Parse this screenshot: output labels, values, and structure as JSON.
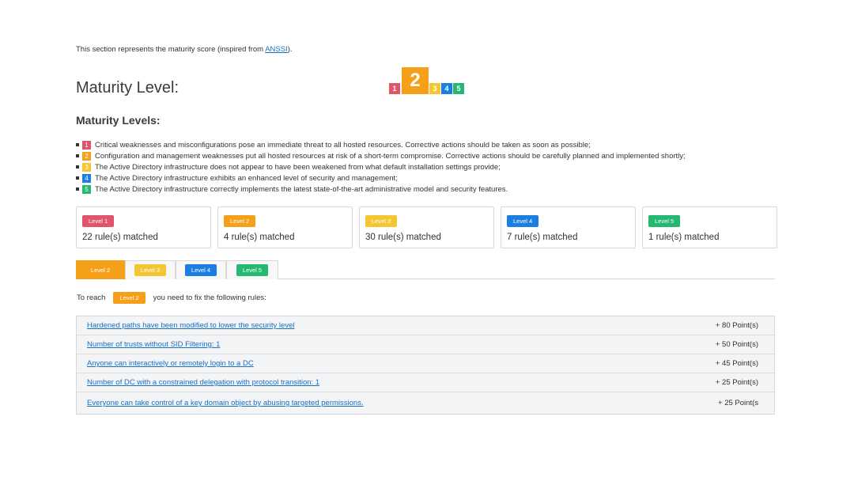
{
  "intro": {
    "text_before": "This section represents the maturity score (inspired from ",
    "link": "ANSSI",
    "text_after": ")."
  },
  "maturity_title": "Maturity Level:",
  "current_level": "2",
  "scale": [
    {
      "label": "1",
      "color": "#e0556b"
    },
    {
      "label": "2",
      "color": "#f6a01a"
    },
    {
      "label": "3",
      "color": "#f5c633"
    },
    {
      "label": "4",
      "color": "#1a7fe0"
    },
    {
      "label": "5",
      "color": "#24b870"
    }
  ],
  "levels_title": "Maturity Levels:",
  "levels": [
    {
      "num": "1",
      "color": "#e0556b",
      "text": "Critical weaknesses and misconfigurations pose an immediate threat to all hosted resources. Corrective actions should be taken as soon as possible;"
    },
    {
      "num": "2",
      "color": "#f6a01a",
      "text": "Configuration and management weaknesses put all hosted resources at risk of a short-term compromise. Corrective actions should be carefully planned and implemented shortly;"
    },
    {
      "num": "3",
      "color": "#f5c633",
      "text": "The Active Directory infrastructure does not appear to have been weakened from what default installation settings provide;"
    },
    {
      "num": "4",
      "color": "#1a7fe0",
      "text": "The Active Directory infrastructure exhibits an enhanced level of security and management;"
    },
    {
      "num": "5",
      "color": "#24b870",
      "text": "The Active Directory infrastructure correctly implements the latest state-of-the-art administrative model and security features."
    }
  ],
  "cards": [
    {
      "badge": "Level 1",
      "color": "#e0556b",
      "count": "22 rule(s) matched"
    },
    {
      "badge": "Level 2",
      "color": "#f6a01a",
      "count": "4 rule(s) matched"
    },
    {
      "badge": "Level 3",
      "color": "#f5c633",
      "count": "30 rule(s) matched"
    },
    {
      "badge": "Level 4",
      "color": "#1a7fe0",
      "count": "7 rule(s) matched"
    },
    {
      "badge": "Level 5",
      "color": "#24b870",
      "count": "1 rule(s) matched"
    }
  ],
  "tabs": [
    {
      "label": "Level 2",
      "color": "#f6a01a",
      "active": true
    },
    {
      "label": "Level 3",
      "color": "#f5c633",
      "active": false
    },
    {
      "label": "Level 4",
      "color": "#1a7fe0",
      "active": false
    },
    {
      "label": "Level 5",
      "color": "#24b870",
      "active": false
    }
  ],
  "reach": {
    "before": "To reach",
    "badge": "Level 2",
    "badge_color": "#f6a01a",
    "after": "you need to fix the following rules:"
  },
  "rules": [
    {
      "name": "Hardened paths have been modified to lower the security level",
      "points": "+ 80 Point(s)"
    },
    {
      "name": "Number of trusts without SID Filtering: 1",
      "points": "+ 50 Point(s)"
    },
    {
      "name": "Anyone can interactively or remotely login to a DC",
      "points": "+ 45 Point(s)"
    },
    {
      "name": "Number of DC with a constrained delegation with protocol transition: 1",
      "points": "+ 25 Point(s)"
    },
    {
      "name": "Everyone can take control of a key domain object by abusing targeted permissions.",
      "points": "+ 25 Point(s"
    }
  ]
}
